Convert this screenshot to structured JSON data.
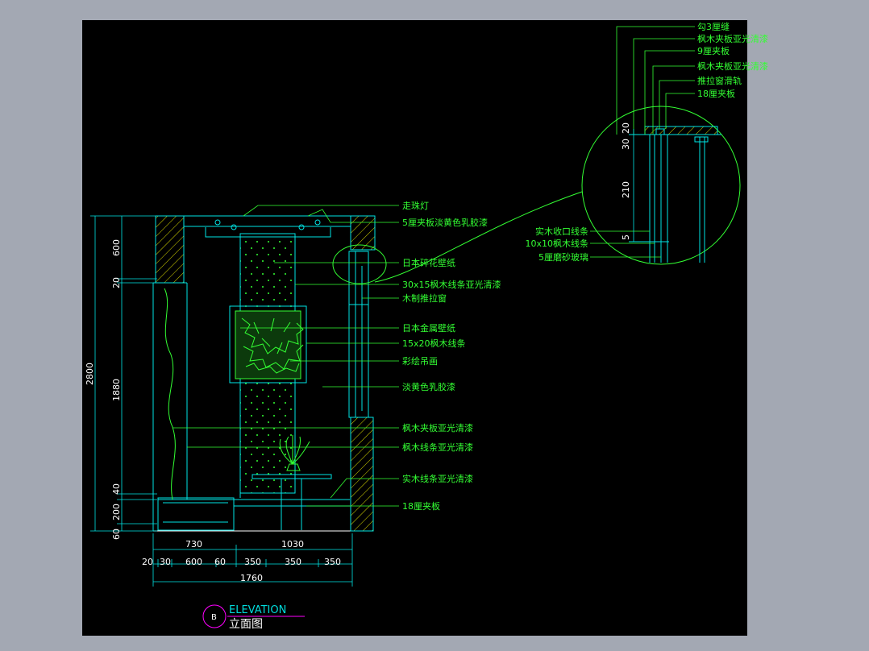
{
  "colors": {
    "workspace": "#a3a8b3",
    "canvas": "#000000",
    "leader_text": "#33ff33",
    "outline": "#00e5e5",
    "dimension_text": "#ffffff",
    "hatch": "#ffff00",
    "bubble": "#ff00ff"
  },
  "title": {
    "bubble": "B",
    "english": "ELEVATION",
    "chinese": "立面图"
  },
  "elevation_labels": [
    "走珠灯",
    "5厘夹板淡黄色乳胶漆",
    "日本碎花壁纸",
    "30x15枫木线条亚光清漆",
    "木制推拉窗",
    "日本金属壁纸",
    "15x20枫木线条",
    "彩绘吊画",
    "淡黄色乳胶漆",
    "枫木夹板亚光清漆",
    "枫木线条亚光清漆",
    "实木线条亚光清漆",
    "18厘夹板"
  ],
  "detail_labels_top": [
    "勾3厘缝",
    "枫木夹板亚光清漆",
    "9厘夹板",
    "枫木夹板亚光清漆",
    "推拉窗滑轨",
    "18厘夹板"
  ],
  "detail_labels_left": [
    "实木收口线条",
    "10x10枫木线条",
    "5厘磨砂玻璃"
  ],
  "detail_dims": [
    "30",
    "20",
    "210",
    "5"
  ],
  "left_dims": {
    "total": "2800",
    "parts": [
      "600",
      "20",
      "1880",
      "40",
      "200",
      "60"
    ]
  },
  "bottom_dims": {
    "row1": [
      "730",
      "1030"
    ],
    "row2": [
      "20",
      "30",
      "600",
      "60",
      "350",
      "350",
      "350"
    ],
    "total": "1760"
  }
}
